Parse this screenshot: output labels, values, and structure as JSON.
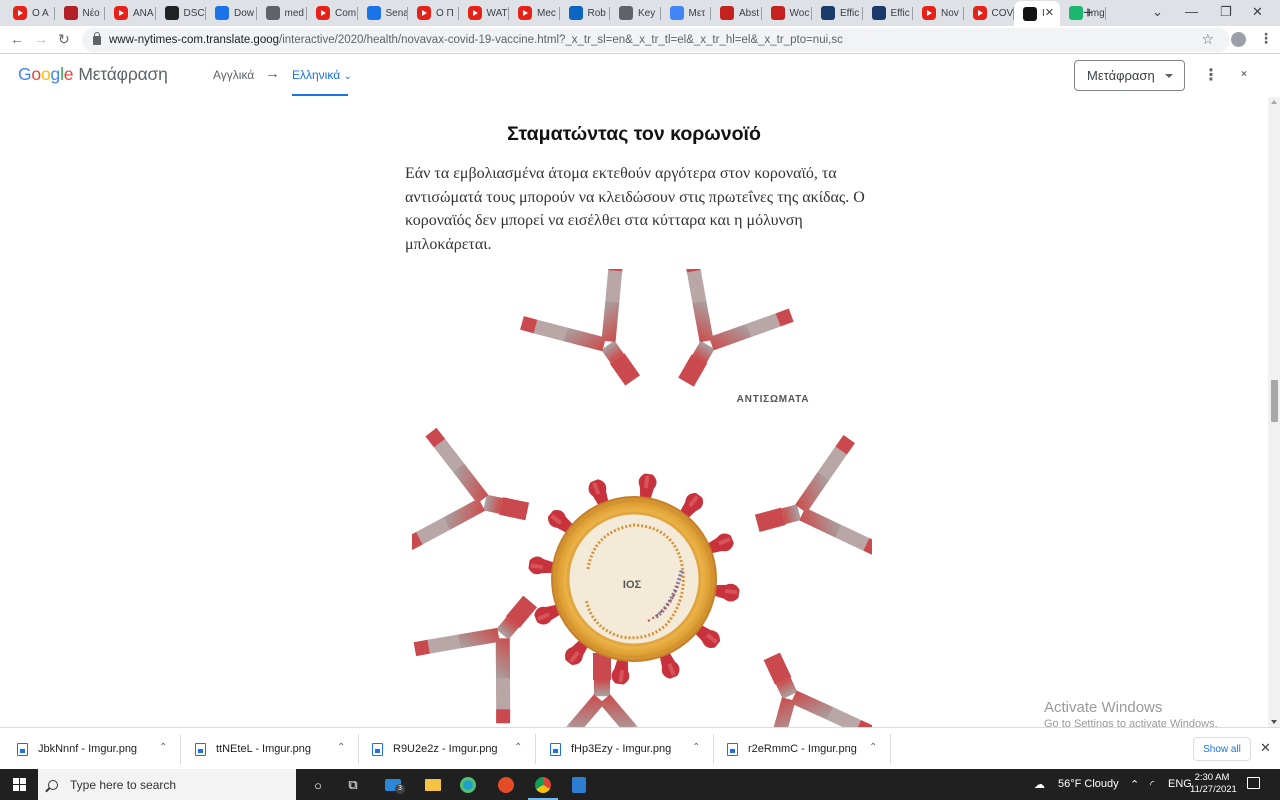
{
  "browser": {
    "tabs": [
      {
        "label": "Ο Α",
        "icon": "youtube-icon",
        "color": "#e62117"
      },
      {
        "label": "Νέο",
        "icon": "red-logo-icon",
        "color": "#b32025"
      },
      {
        "label": "ΑΝΑ",
        "icon": "youtube-icon",
        "color": "#e62117"
      },
      {
        "label": "DSC",
        "icon": "s-logo-icon",
        "color": "#202124"
      },
      {
        "label": "Dow",
        "icon": "download-icon",
        "color": "#1a73e8"
      },
      {
        "label": "med",
        "icon": "globe-icon",
        "color": "#5f6368"
      },
      {
        "label": "Com",
        "icon": "youtube-icon",
        "color": "#e62117"
      },
      {
        "label": "Sena",
        "icon": "play-icon",
        "color": "#1a73e8"
      },
      {
        "label": "Ο Π",
        "icon": "youtube-icon",
        "color": "#e62117"
      },
      {
        "label": "WAT",
        "icon": "youtube-icon",
        "color": "#e62117"
      },
      {
        "label": "Mec",
        "icon": "youtube-icon",
        "color": "#e62117"
      },
      {
        "label": "Rob",
        "icon": "linkedin-icon",
        "color": "#0a66c2"
      },
      {
        "label": "Key",
        "icon": "globe-icon",
        "color": "#5f6368"
      },
      {
        "label": "Μετ",
        "icon": "translate-icon",
        "color": "#4285f4"
      },
      {
        "label": "Abst",
        "icon": "heart-icon",
        "color": "#c5221f"
      },
      {
        "label": "Woc",
        "icon": "wb-logo-icon",
        "color": "#c5221f"
      },
      {
        "label": "Effic",
        "icon": "mr-logo-icon",
        "color": "#1a3a6b"
      },
      {
        "label": "Effic",
        "icon": "mr-logo-icon",
        "color": "#1a3a6b"
      },
      {
        "label": "Nov",
        "icon": "youtube-icon",
        "color": "#e62117"
      },
      {
        "label": "COV",
        "icon": "youtube-icon",
        "color": "#e62117"
      },
      {
        "label": "Ι",
        "icon": "nyt-icon",
        "color": "#121212",
        "active": true
      },
      {
        "label": "Img",
        "icon": "imgur-icon",
        "color": "#1bb76e"
      }
    ],
    "url_host": "www-nytimes-com.translate.goog",
    "url_path": "/interactive/2020/health/novavax-covid-19-vaccine.html?_x_tr_sl=en&_x_tr_tl=el&_x_tr_hl=el&_x_tr_pto=nui,sc"
  },
  "translate_bar": {
    "logo": {
      "g": "G",
      "o1": "o",
      "o2": "o",
      "g2": "g",
      "l": "l",
      "e": "e",
      "product": "Μετάφραση"
    },
    "source_lang": "Αγγλικά",
    "arrow": "→",
    "target_lang": "Ελληνικά",
    "translate_button": "Μετάφραση"
  },
  "article": {
    "heading": "Σταματώντας τον κορωνοϊό",
    "paragraph": "Εάν τα εμβολιασμένα άτομα εκτεθούν αργότερα στον κοροναϊό, τα αντισώματά τους μπορούν να κλειδώσουν στις πρωτεΐνες της ακίδας. Ο κοροναϊός δεν μπορεί να εισέλθει στα κύτταρα και η μόλυνση μπλοκάρεται.",
    "label_antibodies": "ΑΝΤΙΣΩΜΑΤΑ",
    "label_virus": "ΙΟΣ",
    "colors": {
      "spike": "#c8323c",
      "shell": "#e8a83a",
      "antibody": "#c65a5a"
    }
  },
  "watermark": {
    "line1": "Activate Windows",
    "line2": "Go to Settings to activate Windows."
  },
  "downloads": [
    {
      "name": "JbkNnnf - Imgur.png"
    },
    {
      "name": "ttNEteL - Imgur.png"
    },
    {
      "name": "R9U2e2z - Imgur.png"
    },
    {
      "name": "fHp3Ezy - Imgur.png"
    },
    {
      "name": "r2eRmmC - Imgur.png"
    }
  ],
  "show_all": "Show all",
  "taskbar": {
    "search_placeholder": "Type here to search",
    "mail_badge": "3",
    "weather": "56°F  Cloudy",
    "lang": "ENG",
    "time": "2:30 AM",
    "date": "11/27/2021"
  }
}
